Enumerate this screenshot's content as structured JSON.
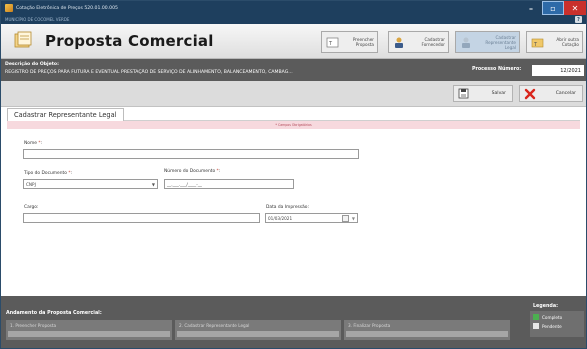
{
  "window": {
    "title": "Cotação Eletrônica de Preços 520.01.00.005",
    "subtitle": "MUNICÍPIO DE COCOMEL VERDE",
    "help": "?"
  },
  "header": {
    "title": "Proposta Comercial"
  },
  "toolbar": [
    {
      "label": "Preencher Proposta"
    },
    {
      "label": "Cadastrar Fornecedor"
    },
    {
      "label": "Cadastrar Representante Legal"
    },
    {
      "label": "Abrir outra Cotação"
    }
  ],
  "object": {
    "label": "Descrição do Objeto:",
    "text": "REGISTRO DE PREÇOS PARA FUTURA E EVENTUAL PRESTAÇÃO DE SERVIÇO DE ALINHAMENTO, BALANCEAMENTO, CAMBAG...",
    "process_label": "Processo Número:",
    "process_value": "12/2021"
  },
  "actions": {
    "save": "Salvar",
    "cancel": "Cancelar"
  },
  "tab": {
    "label": "Cadastrar Representante Legal"
  },
  "form": {
    "required_note": "* Campos Obrigatórios",
    "name_label": "Nome",
    "name_value": "",
    "doc_type_label": "Tipo do Documento",
    "doc_type_value": "CNPJ",
    "doc_number_label": "Número do Documento",
    "doc_number_value": "__.___.___/____-__",
    "role_label": "Cargo",
    "role_value": "",
    "print_date_label": "Data da Impressão:",
    "print_date_value": "01/03/2021",
    "required_mark": "*",
    "colon_sep": ":"
  },
  "progress": {
    "title": "Andamento da Proposta Comercial:",
    "steps": [
      "1. Preencher Proposta",
      "2. Cadastrar Representante Legal",
      "3. Finalizar Proposta"
    ]
  },
  "legend": {
    "title": "Legenda:",
    "items": [
      {
        "label": "Completo",
        "color": "#4caf50"
      },
      {
        "label": "Pendente",
        "color": "#e6e6e6"
      }
    ]
  }
}
